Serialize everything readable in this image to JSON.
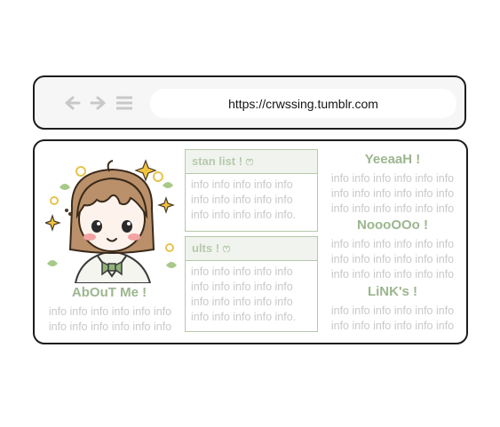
{
  "browser": {
    "url": "https://crwssing.tumblr.com",
    "icons": [
      "back-arrow-icon",
      "forward-arrow-icon",
      "menu-icon"
    ]
  },
  "colors": {
    "accent": "#9cb68f",
    "filler_text": "#c9c9c9",
    "box_border": "#b5c9a9",
    "box_header_bg": "#f1f4ee"
  },
  "about": {
    "title": "AbOuT Me !",
    "lines": [
      "info info info info info info",
      "info info info info info info"
    ]
  },
  "stan_list": {
    "title": "stan list ! ෆ",
    "lines": [
      "info info info info info",
      "info info info info info",
      "info info info info info."
    ]
  },
  "ults": {
    "title": "ults ! ෆ",
    "lines": [
      "info info info info info",
      "info info info info info",
      "info info info info info",
      "info info info info info."
    ]
  },
  "yeah": {
    "title": "YeeaaH !",
    "lines": [
      "info info info info info info",
      "info info info info info info",
      "info info info info info info"
    ]
  },
  "nooo": {
    "title": "NoooOOo !",
    "lines": [
      "info info info info info info",
      "info info info info info info",
      "info info info info info info"
    ]
  },
  "links": {
    "title": "LiNK's !",
    "lines": [
      "info info info info info info",
      "info info info info info info"
    ]
  }
}
